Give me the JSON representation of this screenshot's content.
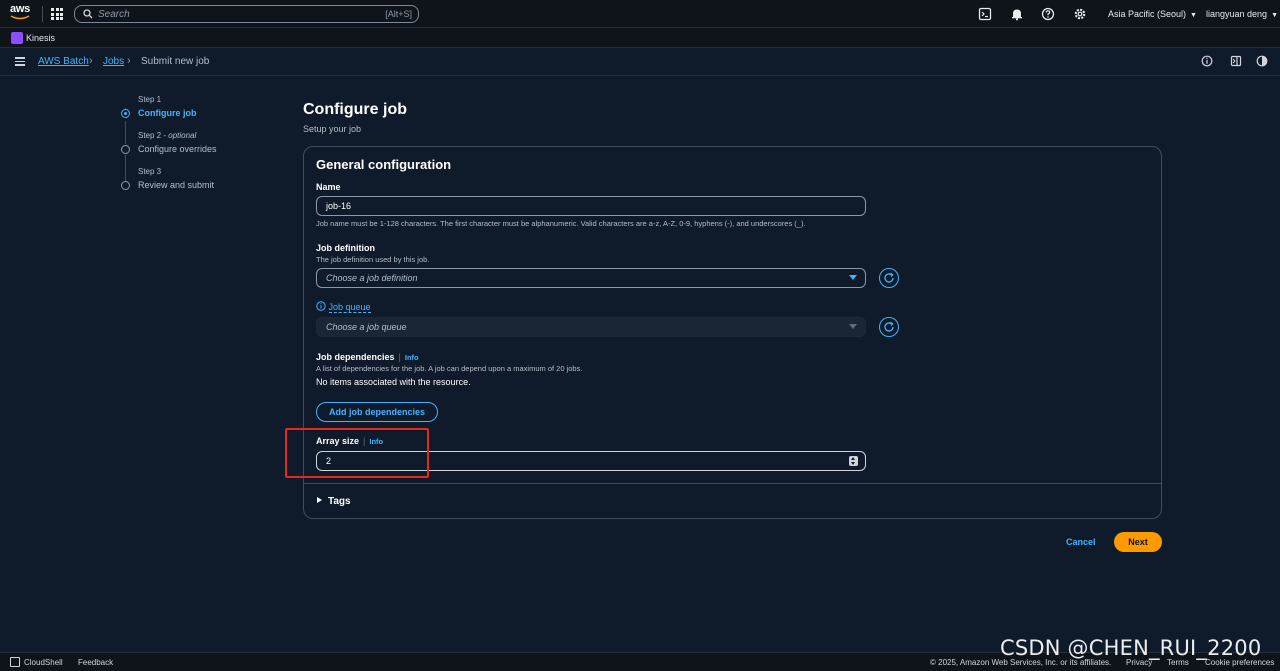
{
  "topnav": {
    "logo_text": "aws",
    "search_placeholder": "Search",
    "search_shortcut": "[Alt+S]",
    "region": "Asia Pacific (Seoul)",
    "user": "liangyuan deng"
  },
  "servicebar": {
    "service": "Kinesis"
  },
  "breadcrumb": {
    "items": [
      "AWS Batch",
      "Jobs",
      "Submit new job"
    ]
  },
  "steps": [
    {
      "num": "Step 1",
      "optional": "",
      "title": "Configure job"
    },
    {
      "num": "Step 2 - ",
      "optional": "optional",
      "title": "Configure overrides"
    },
    {
      "num": "Step 3",
      "optional": "",
      "title": "Review and submit"
    }
  ],
  "main": {
    "title": "Configure job",
    "subtitle": "Setup your job",
    "container_title": "General configuration",
    "name_label": "Name",
    "name_value": "job-16",
    "name_hint": "Job name must be 1-128 characters. The first character must be alphanumeric. Valid characters are a-z, A-Z, 0-9, hyphens (-), and underscores (_).",
    "jobdef_label": "Job definition",
    "jobdef_desc": "The job definition used by this job.",
    "jobdef_placeholder": "Choose a job definition",
    "queue_label": "Job queue",
    "queue_placeholder": "Choose a job queue",
    "deps_label": "Job dependencies",
    "info": "Info",
    "deps_desc": "A list of dependencies for the job. A job can depend upon a maximum of 20 jobs.",
    "deps_empty": "No items associated with the resource.",
    "deps_button": "Add job dependencies",
    "array_label": "Array size",
    "array_value": "2",
    "tags": "Tags",
    "cancel": "Cancel",
    "next": "Next"
  },
  "footer": {
    "cloudshell": "CloudShell",
    "feedback": "Feedback",
    "copyright": "© 2025, Amazon Web Services, Inc. or its affiliates.",
    "privacy": "Privacy",
    "terms": "Terms",
    "cookie": "Cookie preferences"
  },
  "watermark": "CSDN @CHEN_RUI_2200",
  "colors": {
    "accent": "#42b4ff",
    "primary_button": "#ff9900",
    "highlight_box": "#e5281c",
    "background": "#0f1b2a"
  }
}
